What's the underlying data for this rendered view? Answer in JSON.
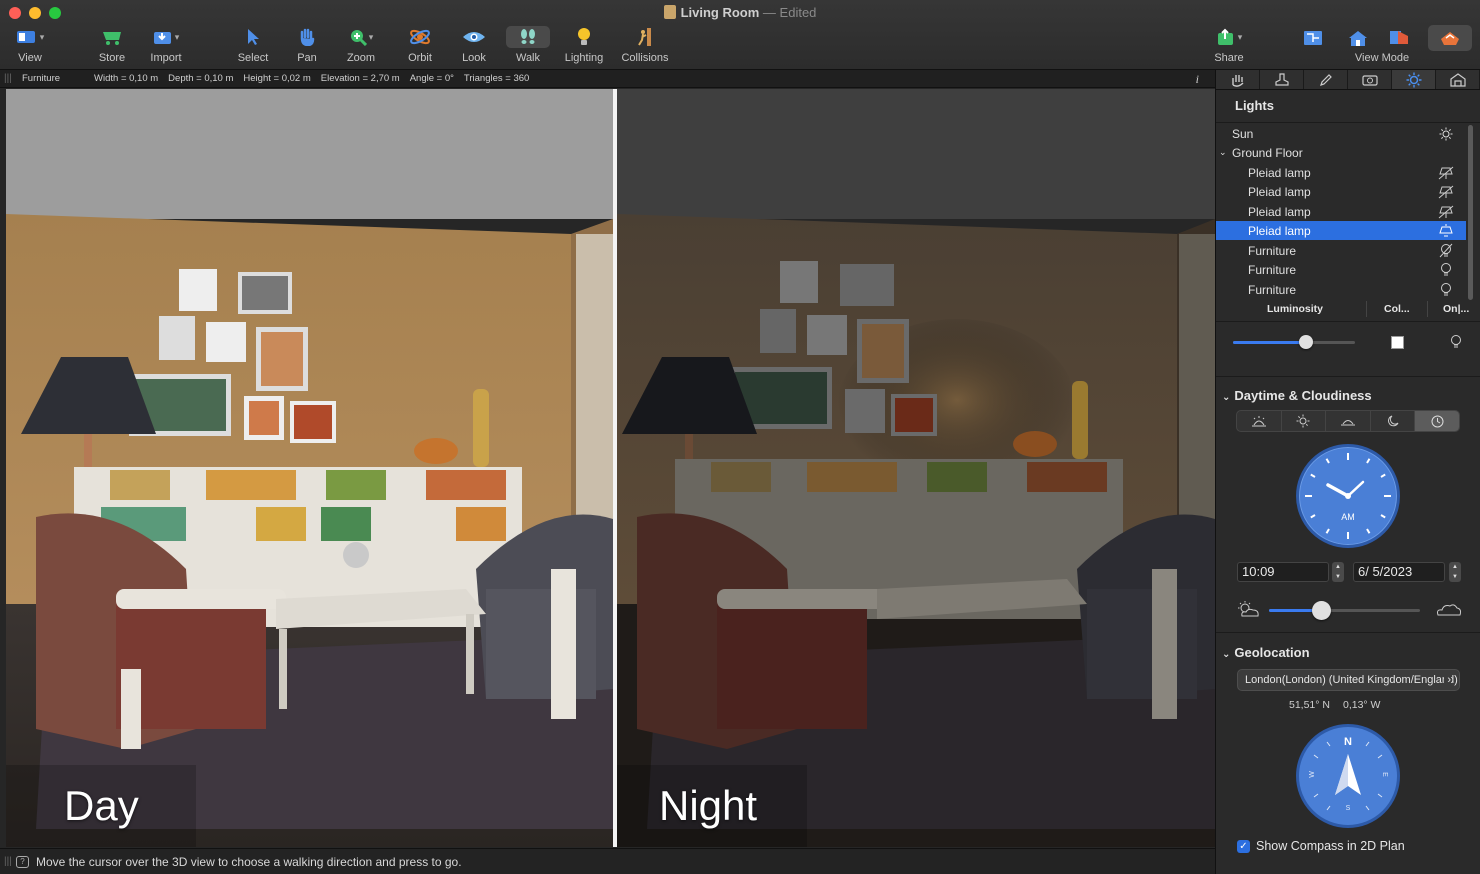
{
  "window": {
    "title": "Living Room",
    "title_sep": "—",
    "status": "Edited"
  },
  "toolbar": {
    "left": [
      {
        "label": "View",
        "icon": "view-icon"
      },
      {
        "label": "Store",
        "icon": "store-icon"
      },
      {
        "label": "Import",
        "icon": "import-icon"
      },
      {
        "label": "Select",
        "icon": "select-arrow-icon"
      },
      {
        "label": "Pan",
        "icon": "hand-icon"
      },
      {
        "label": "Zoom",
        "icon": "zoom-icon"
      },
      {
        "label": "Orbit",
        "icon": "orbit-icon"
      },
      {
        "label": "Look",
        "icon": "eye-icon"
      },
      {
        "label": "Walk",
        "icon": "footprints-icon"
      },
      {
        "label": "Lighting",
        "icon": "bulb-icon"
      },
      {
        "label": "Collisions",
        "icon": "collisions-icon"
      }
    ],
    "right": [
      {
        "label": "Share",
        "icon": "share-icon"
      },
      {
        "label": "View Mode",
        "icon": "view-mode-icon"
      }
    ],
    "active": "Walk"
  },
  "infobar": {
    "object": "Furniture",
    "width": "Width = 0,10 m",
    "depth": "Depth = 0,10 m",
    "height": "Height = 0,02 m",
    "elevation": "Elevation = 2,70 m",
    "angle": "Angle = 0°",
    "triangles": "Triangles = 360",
    "info": "i"
  },
  "views": {
    "day_caption": "Day",
    "night_caption": "Night"
  },
  "statusbar": {
    "message": "Move the cursor over the 3D view to choose a walking direction and press to go."
  },
  "panel": {
    "tabs": [
      "hand-tab-icon",
      "stamp-tab-icon",
      "pencil-tab-icon",
      "camera-tab-icon",
      "sun-tab-icon",
      "house-tab-icon"
    ],
    "active_tab": 4,
    "lights": {
      "title": "Lights",
      "items": [
        {
          "label": "Sun",
          "indent": 0,
          "icon": "sun-icon",
          "selected": false
        },
        {
          "label": "Ground Floor",
          "indent": 0,
          "icon": "",
          "group": true,
          "selected": false
        },
        {
          "label": "Pleiad lamp",
          "indent": 1,
          "icon": "lamp-off-icon",
          "selected": false
        },
        {
          "label": "Pleiad lamp",
          "indent": 1,
          "icon": "lamp-off-icon",
          "selected": false
        },
        {
          "label": "Pleiad lamp",
          "indent": 1,
          "icon": "lamp-off-icon",
          "selected": false
        },
        {
          "label": "Pleiad lamp",
          "indent": 1,
          "icon": "lamp-on-icon",
          "selected": true
        },
        {
          "label": "Furniture",
          "indent": 1,
          "icon": "bulb-off-icon",
          "selected": false
        },
        {
          "label": "Furniture",
          "indent": 1,
          "icon": "bulb-icon",
          "selected": false
        },
        {
          "label": "Furniture",
          "indent": 1,
          "icon": "bulb-icon",
          "selected": false
        }
      ],
      "columns": [
        "Luminosity",
        "Col...",
        "On|..."
      ],
      "luminosity": 0.6
    },
    "daytime": {
      "title": "Daytime & Cloudiness",
      "modes": [
        "sunrise-icon",
        "sun-icon",
        "sunset-icon",
        "moon-icon",
        "clock-icon"
      ],
      "selected_mode": 4,
      "clock_label": "AM",
      "time": "10:09",
      "date": "6/ 5/2023",
      "cloudiness": 0.35
    },
    "geolocation": {
      "title": "Geolocation",
      "location": "London(London) (United Kingdom/England)",
      "lat": "51,51° N",
      "lon": "0,13° W",
      "compass_n": "N",
      "compass_s": "S",
      "compass_e": "E",
      "compass_w": "W",
      "show_compass_label": "Show Compass in 2D Plan",
      "show_compass": true
    }
  }
}
